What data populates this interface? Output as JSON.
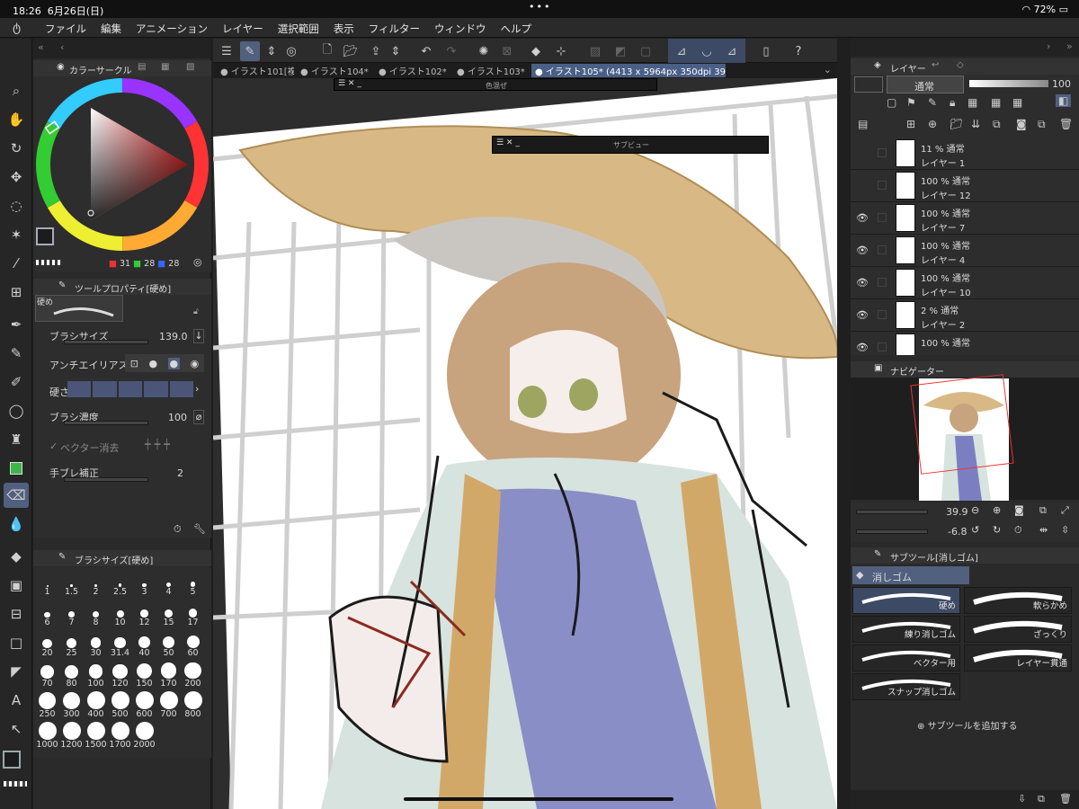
{
  "status": {
    "time": "18:26",
    "date": "6月26日(日)",
    "battery": "72%"
  },
  "menu": [
    "ファイル",
    "編集",
    "アニメーション",
    "レイヤー",
    "選択範囲",
    "表示",
    "フィルター",
    "ウィンドウ",
    "ヘルプ"
  ],
  "color_panel": {
    "title": "カラーサークル",
    "r": "31",
    "g": "28",
    "b": "28"
  },
  "tool_property": {
    "title": "ツールプロパティ[硬め]",
    "preset": "硬め",
    "brush_size_label": "ブラシサイズ",
    "brush_size_value": "139.0",
    "antialias_label": "アンチエイリアス",
    "hardness_label": "硬さ",
    "density_label": "ブラシ濃度",
    "density_value": "100",
    "vector_erase_label": "ベクター消去",
    "stabilization_label": "手ブレ補正",
    "stabilization_value": "2"
  },
  "brush_size_panel": {
    "title": "ブラシサイズ[硬め]",
    "sizes": [
      "1",
      "1.5",
      "2",
      "2.5",
      "3",
      "4",
      "5",
      "6",
      "7",
      "8",
      "10",
      "12",
      "15",
      "17",
      "20",
      "25",
      "30",
      "31.4",
      "40",
      "50",
      "60",
      "70",
      "80",
      "100",
      "120",
      "150",
      "170",
      "200",
      "250",
      "300",
      "400",
      "500",
      "600",
      "700",
      "800",
      "1000",
      "1200",
      "1500",
      "1700",
      "2000"
    ]
  },
  "tabs": [
    "イラスト101[複",
    "イラスト104*",
    "イラスト102*",
    "イラスト103*",
    "イラスト105* (4413 x 5964px 350dpi 39.9%)"
  ],
  "float_windows": {
    "color_mix": "色混ぜ",
    "subview": "サブビュー"
  },
  "layer_panel": {
    "title": "レイヤー",
    "blend_mode": "通常",
    "opacity": "100",
    "layers": [
      {
        "mode": "11 % 通常",
        "name": "レイヤー 1",
        "visible": false
      },
      {
        "mode": "100 % 通常",
        "name": "レイヤー 12",
        "visible": false
      },
      {
        "mode": "100 % 通常",
        "name": "レイヤー 7",
        "visible": true
      },
      {
        "mode": "100 % 通常",
        "name": "レイヤー 4",
        "visible": true
      },
      {
        "mode": "100 % 通常",
        "name": "レイヤー 10",
        "visible": true
      },
      {
        "mode": "2 % 通常",
        "name": "レイヤー 2",
        "visible": true
      },
      {
        "mode": "100 % 通常",
        "name": "",
        "visible": true
      }
    ]
  },
  "navigator": {
    "title": "ナビゲーター",
    "zoom": "39.9",
    "rotation": "-6.8"
  },
  "subtool": {
    "title": "サブツール[消しゴム]",
    "group": "消しゴム",
    "items": [
      "硬め",
      "軟らかめ",
      "練り消しゴム",
      "ざっくり",
      "ベクター用",
      "レイヤー貫通",
      "スナップ消しゴム"
    ],
    "add_label": "サブツールを追加する"
  },
  "icons": [
    "search-icon",
    "hand-icon",
    "rotate-icon",
    "move-icon",
    "lasso-icon",
    "magic-wand-icon",
    "eyedropper-icon",
    "grid-icon",
    "pen-icon",
    "pencil-icon",
    "brush-icon",
    "speech-bubble-icon",
    "airbrush-icon",
    "decoration-icon",
    "eraser-icon",
    "blend-icon",
    "fill-icon",
    "gradient-icon",
    "frame-icon",
    "figure-icon",
    "ruler-icon",
    "text-icon",
    "correct-line-icon"
  ]
}
